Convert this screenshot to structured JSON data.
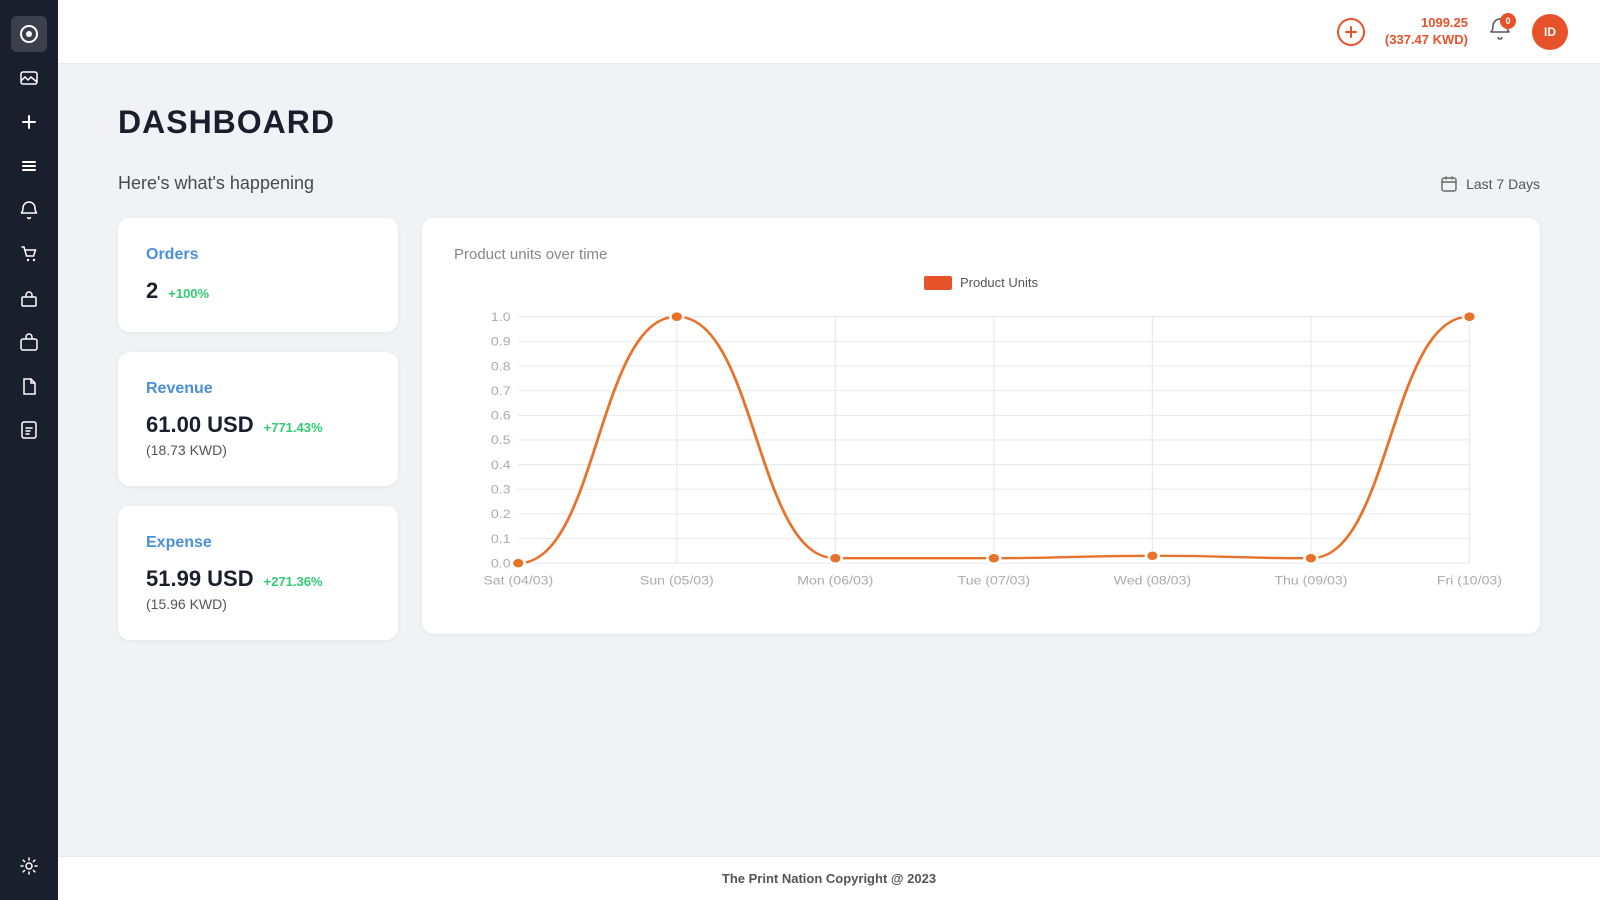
{
  "sidebar": {
    "icons": [
      {
        "name": "dashboard-icon",
        "symbol": "⬤",
        "active": true
      },
      {
        "name": "image-icon",
        "symbol": "🖼"
      },
      {
        "name": "add-icon",
        "symbol": "+"
      },
      {
        "name": "menu-icon",
        "symbol": "▤"
      },
      {
        "name": "bell-icon",
        "symbol": "🔔"
      },
      {
        "name": "cart-icon",
        "symbol": "🛒"
      },
      {
        "name": "shop-icon",
        "symbol": "🛍"
      },
      {
        "name": "briefcase-icon",
        "symbol": "💼"
      },
      {
        "name": "file-icon",
        "symbol": "📄"
      },
      {
        "name": "report-icon",
        "symbol": "📋"
      },
      {
        "name": "settings-icon",
        "symbol": "⚙"
      }
    ]
  },
  "topbar": {
    "balance_primary": "1099.25",
    "balance_secondary": "(337.47 KWD)",
    "notification_count": "0",
    "user_id": "ID",
    "add_label": "+"
  },
  "page": {
    "title": "DASHBOARD",
    "subtitle": "Here's what's happening",
    "date_filter": "Last 7 Days"
  },
  "cards": [
    {
      "title": "Orders",
      "value": "2",
      "change": "+100%",
      "change_type": "positive",
      "sub": ""
    },
    {
      "title": "Revenue",
      "value": "61.00 USD",
      "change": "+771.43%",
      "change_type": "positive",
      "sub": "(18.73 KWD)"
    },
    {
      "title": "Expense",
      "value": "51.99 USD",
      "change": "+271.36%",
      "change_type": "positive",
      "sub": "(15.96 KWD)"
    }
  ],
  "chart": {
    "title": "Product units over time",
    "legend_label": "Product Units",
    "x_labels": [
      "Sat (04/03)",
      "Sun (05/03)",
      "Mon (06/03)",
      "Tue (07/03)",
      "Wed (08/03)",
      "Thu (09/03)",
      "Fri (10/03)"
    ],
    "y_labels": [
      "0",
      "0.1",
      "0.2",
      "0.3",
      "0.4",
      "0.5",
      "0.6",
      "0.7",
      "0.8",
      "0.9",
      "1.0"
    ],
    "data_points": [
      0,
      1.0,
      0.02,
      0.02,
      0.03,
      0.02,
      1.0
    ],
    "color": "#e8722a"
  },
  "footer": {
    "text": "The Print Nation Copyright @ 2023"
  }
}
